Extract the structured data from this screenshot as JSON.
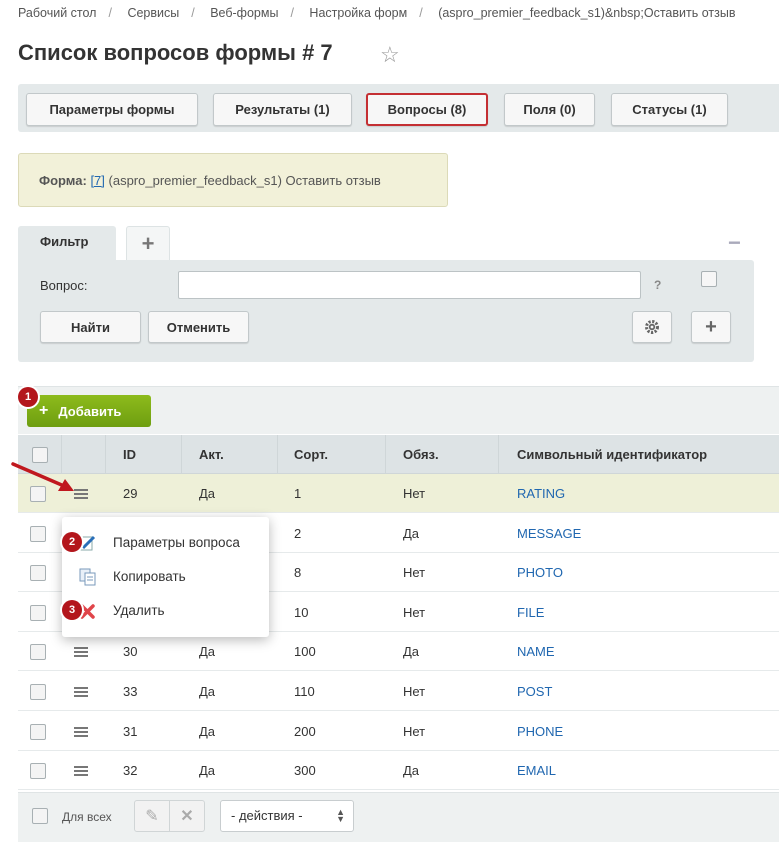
{
  "breadcrumbs": [
    "Рабочий стол",
    "Сервисы",
    "Веб-формы",
    "Настройка форм",
    "(aspro_premier_feedback_s1)&nbsp;Оставить отзыв"
  ],
  "page_title": "Список вопросов формы # 7",
  "tabs": [
    {
      "label": "Параметры формы"
    },
    {
      "label": "Результаты (1)"
    },
    {
      "label": "Вопросы (8)",
      "active": true
    },
    {
      "label": "Поля (0)"
    },
    {
      "label": "Статусы (1)"
    }
  ],
  "info": {
    "label": "Форма:",
    "link": "[7]",
    "text": " (aspro_premier_feedback_s1) Оставить отзыв"
  },
  "filter": {
    "tab_label": "Фильтр",
    "add_tab": "+",
    "minus": "−",
    "question_label": "Вопрос:",
    "question_value": "",
    "help": "?",
    "find_label": "Найти",
    "cancel_label": "Отменить",
    "plus": "+"
  },
  "toolbar": {
    "add_label": "Добавить",
    "plus": "+"
  },
  "badges": [
    "1",
    "2",
    "3"
  ],
  "table": {
    "columns": [
      "ID",
      "Акт.",
      "Сорт.",
      "Обяз.",
      "Символьный идентификатор"
    ],
    "rows": [
      {
        "id": "29",
        "act": "Да",
        "sort": "1",
        "req": "Нет",
        "code": "RATING"
      },
      {
        "id": "",
        "act": "",
        "sort": "2",
        "req": "Да",
        "code": "MESSAGE"
      },
      {
        "id": "",
        "act": "",
        "sort": "8",
        "req": "Нет",
        "code": "PHOTO"
      },
      {
        "id": "",
        "act": "",
        "sort": "10",
        "req": "Нет",
        "code": "FILE"
      },
      {
        "id": "30",
        "act": "Да",
        "sort": "100",
        "req": "Да",
        "code": "NAME"
      },
      {
        "id": "33",
        "act": "Да",
        "sort": "110",
        "req": "Нет",
        "code": "POST"
      },
      {
        "id": "31",
        "act": "Да",
        "sort": "200",
        "req": "Нет",
        "code": "PHONE"
      },
      {
        "id": "32",
        "act": "Да",
        "sort": "300",
        "req": "Да",
        "code": "EMAIL"
      }
    ]
  },
  "context_menu": [
    {
      "label": "Параметры вопроса",
      "icon": "edit-icon"
    },
    {
      "label": "Копировать",
      "icon": "copy-icon"
    },
    {
      "label": "Удалить",
      "icon": "delete-icon"
    }
  ],
  "footer": {
    "for_all": "Для всех",
    "actions_select": "- действия -"
  }
}
